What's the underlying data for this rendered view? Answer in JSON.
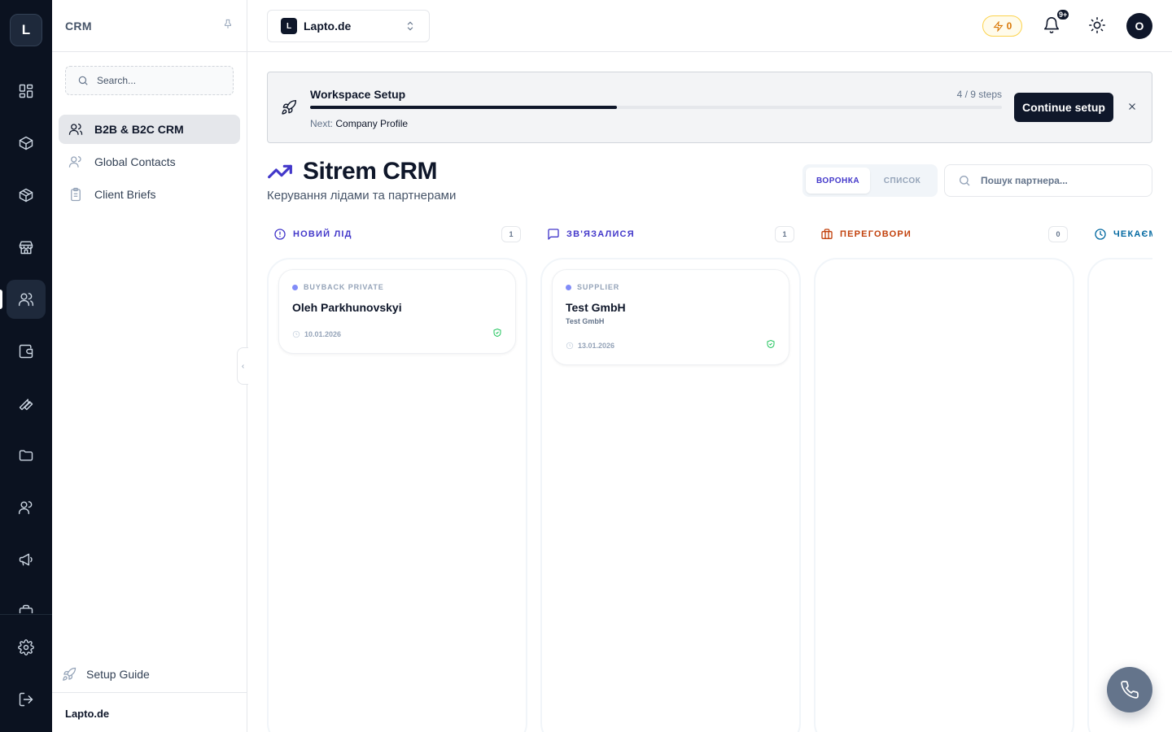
{
  "rail": {
    "logo": "L",
    "items": [
      {
        "icon": "dashboard-icon",
        "active": false
      },
      {
        "icon": "box-icon",
        "active": false
      },
      {
        "icon": "package-icon",
        "active": false
      },
      {
        "icon": "store-icon",
        "active": false
      },
      {
        "icon": "users-icon",
        "active": true
      },
      {
        "icon": "wallet-icon",
        "active": false
      },
      {
        "icon": "wrench-icon",
        "active": false
      },
      {
        "icon": "folder-icon",
        "active": false
      },
      {
        "icon": "team-icon",
        "active": false
      },
      {
        "icon": "megaphone-icon",
        "active": false
      },
      {
        "icon": "briefcase-icon",
        "active": false
      }
    ],
    "bottom": [
      {
        "icon": "settings-icon"
      },
      {
        "icon": "logout-icon"
      }
    ]
  },
  "sidebar": {
    "title": "CRM",
    "search_placeholder": "Search...",
    "items": [
      {
        "label": "B2B & B2C CRM",
        "icon": "users-icon",
        "active": true
      },
      {
        "label": "Global Contacts",
        "icon": "contacts-icon",
        "active": false
      },
      {
        "label": "Client Briefs",
        "icon": "clipboard-icon",
        "active": false
      }
    ],
    "setup_guide": "Setup Guide",
    "footer": "Lapto.de"
  },
  "topbar": {
    "workspace_initial": "L",
    "workspace_name": "Lapto.de",
    "credits": "0",
    "notifications_badge": "9+",
    "avatar_initial": "O"
  },
  "setup": {
    "title": "Workspace Setup",
    "steps": "4 / 9 steps",
    "progress": 0.444,
    "next_label": "Next:",
    "next_step": "Company Profile",
    "button": "Continue setup"
  },
  "page": {
    "title": "Sitrem CRM",
    "subtitle": "Керування лідами та партнерами",
    "view_funnel": "ВОРОНКА",
    "view_list": "СПИСОК",
    "search_placeholder": "Пошук партнера..."
  },
  "columns": [
    {
      "title": "НОВИЙ ЛІД",
      "count": "1",
      "color": "#4338ca",
      "icon": "alert-circle-icon",
      "cards": [
        {
          "tag": "BUYBACK PRIVATE",
          "name": "Oleh Parkhunovskyi",
          "sub": "",
          "date": "10.01.2026"
        }
      ]
    },
    {
      "title": "ЗВ'ЯЗАЛИСЯ",
      "count": "1",
      "color": "#4338ca",
      "icon": "message-icon",
      "cards": [
        {
          "tag": "SUPPLIER",
          "name": "Test GmbH",
          "sub": "Test GmbH",
          "date": "13.01.2026"
        }
      ]
    },
    {
      "title": "ПЕРЕГОВОРИ",
      "count": "0",
      "color": "#c2410c",
      "icon": "briefcase-icon",
      "cards": []
    },
    {
      "title": "ЧЕКАЄМО",
      "count": "",
      "color": "#0369a1",
      "icon": "clock-icon",
      "cards": []
    }
  ]
}
